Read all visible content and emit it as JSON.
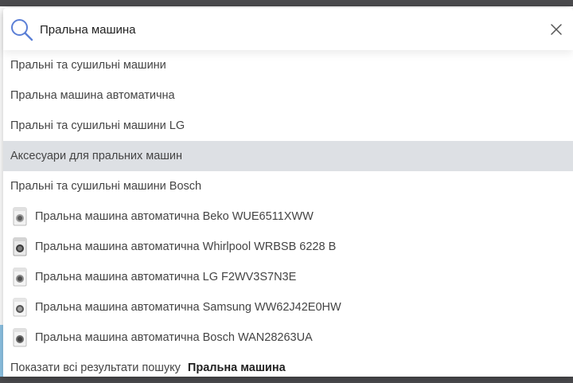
{
  "search": {
    "value": "Пральна машина",
    "icon": "search-icon",
    "close_icon": "close-icon",
    "accent": "#5b7fd6"
  },
  "suggestions": [
    {
      "label": "Пральні та сушильні машини"
    },
    {
      "label": "Пральна машина автоматична"
    },
    {
      "label": "Пральні та сушильні машини LG"
    },
    {
      "label": "Аксесуари для пральних машин",
      "highlighted": true
    },
    {
      "label": "Пральні та сушильні машини Bosch"
    }
  ],
  "products": [
    {
      "label": "Пральна машина автоматична Beko WUE6511XWW",
      "icon": "washing-machine-icon"
    },
    {
      "label": "Пральна машина автоматична Whirlpool WRBSB 6228 B",
      "icon": "washing-machine-icon"
    },
    {
      "label": "Пральна машина автоматична LG F2WV3S7N3E",
      "icon": "washing-machine-icon"
    },
    {
      "label": "Пральна машина автоматична Samsung WW62J42E0HW",
      "icon": "washing-machine-icon"
    },
    {
      "label": "Пральна машина автоматична Bosch WAN28263UA",
      "icon": "washing-machine-icon"
    }
  ],
  "show_all": {
    "label": "Показати всі результати пошуку",
    "query": "Пральна машина"
  },
  "colors": {
    "highlight_row": "#dde0e4",
    "overlay_header": "#4a4a4d"
  }
}
